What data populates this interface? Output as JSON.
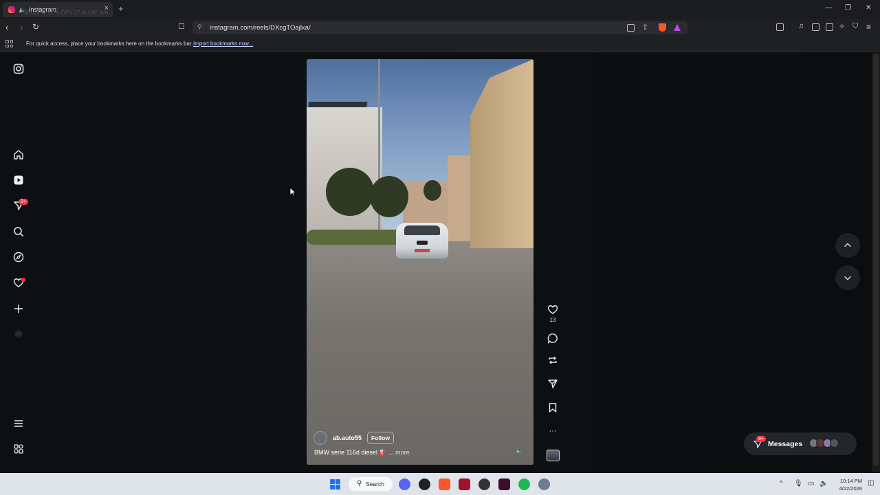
{
  "browser": {
    "tab_title": "Instagram",
    "tab_ghost_overlay": "N/A  GPU 11 %   CPU 17 %   LAT N/A",
    "url": "instagram.com/reels/DXcgTOajlxa/",
    "bookmarks_message": "For quick access, place your bookmarks here on the bookmarks bar.",
    "bookmarks_link": "Import bookmarks now..."
  },
  "sidebar": {
    "notifications_badge": "9+"
  },
  "reel": {
    "author": "ab.auto55",
    "follow_label": "Follow",
    "caption": "BMW série 116d diesel",
    "caption_emoji": "⛽",
    "caption_ellipsis": " ... ",
    "more_label": "more",
    "like_count": "13",
    "more_actions": "···"
  },
  "messages": {
    "label": "Messages",
    "badge": "9+"
  },
  "taskbar": {
    "search_label": "Search",
    "time": "10:14 PM",
    "date": "4/22/2026"
  },
  "colors": {
    "accent_badge": "#ff3040",
    "page_bg": "#0c0e10"
  }
}
